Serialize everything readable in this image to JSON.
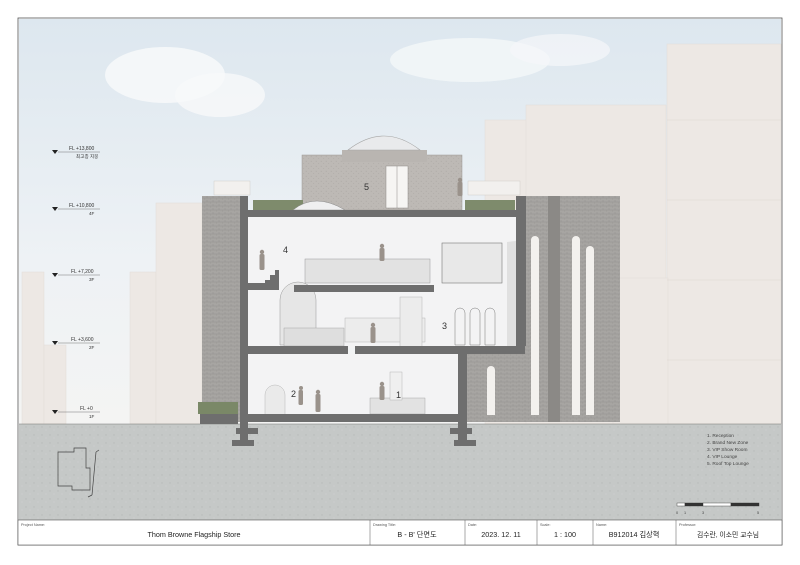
{
  "levels": [
    {
      "elevation": "FL +13,800",
      "name": "최고층 지붕"
    },
    {
      "elevation": "FL +10,800",
      "name": "4F"
    },
    {
      "elevation": "FL +7,200",
      "name": "3F"
    },
    {
      "elevation": "FL +3,600",
      "name": "2F"
    },
    {
      "elevation": "FL +0",
      "name": "1F"
    }
  ],
  "room_numbers": [
    "1",
    "2",
    "3",
    "4",
    "5"
  ],
  "legend": [
    "1.   Reception",
    "2.   Brand New Zone",
    "3.   VIP Show Room",
    "4.   VIP Lounge",
    "5.   Roof Top Lounge"
  ],
  "scale_bar": {
    "ticks": [
      "0",
      "1",
      "3",
      "5"
    ]
  },
  "title_block": {
    "project_label": "Project Name:",
    "project_value": "Thom Browne Flagship Store",
    "drawing_label": "Drawing Title:",
    "drawing_value": "B - B' 단면도",
    "date_label": "Date:",
    "date_value": "2023. 12. 11",
    "scale_label": "Scale:",
    "scale_value": "1 : 100",
    "name_label": "Name:",
    "name_value": "B912014 김상혁",
    "professor_label": "Professor:",
    "professor_value": "김수란, 이소민 교수님"
  },
  "colors": {
    "wall_poured": "#6e6e6e",
    "ground": "#c4c7c6",
    "brick": "#a9a7a4",
    "neighbor_building": "#ede8e4",
    "sky": "#e7eef3"
  }
}
